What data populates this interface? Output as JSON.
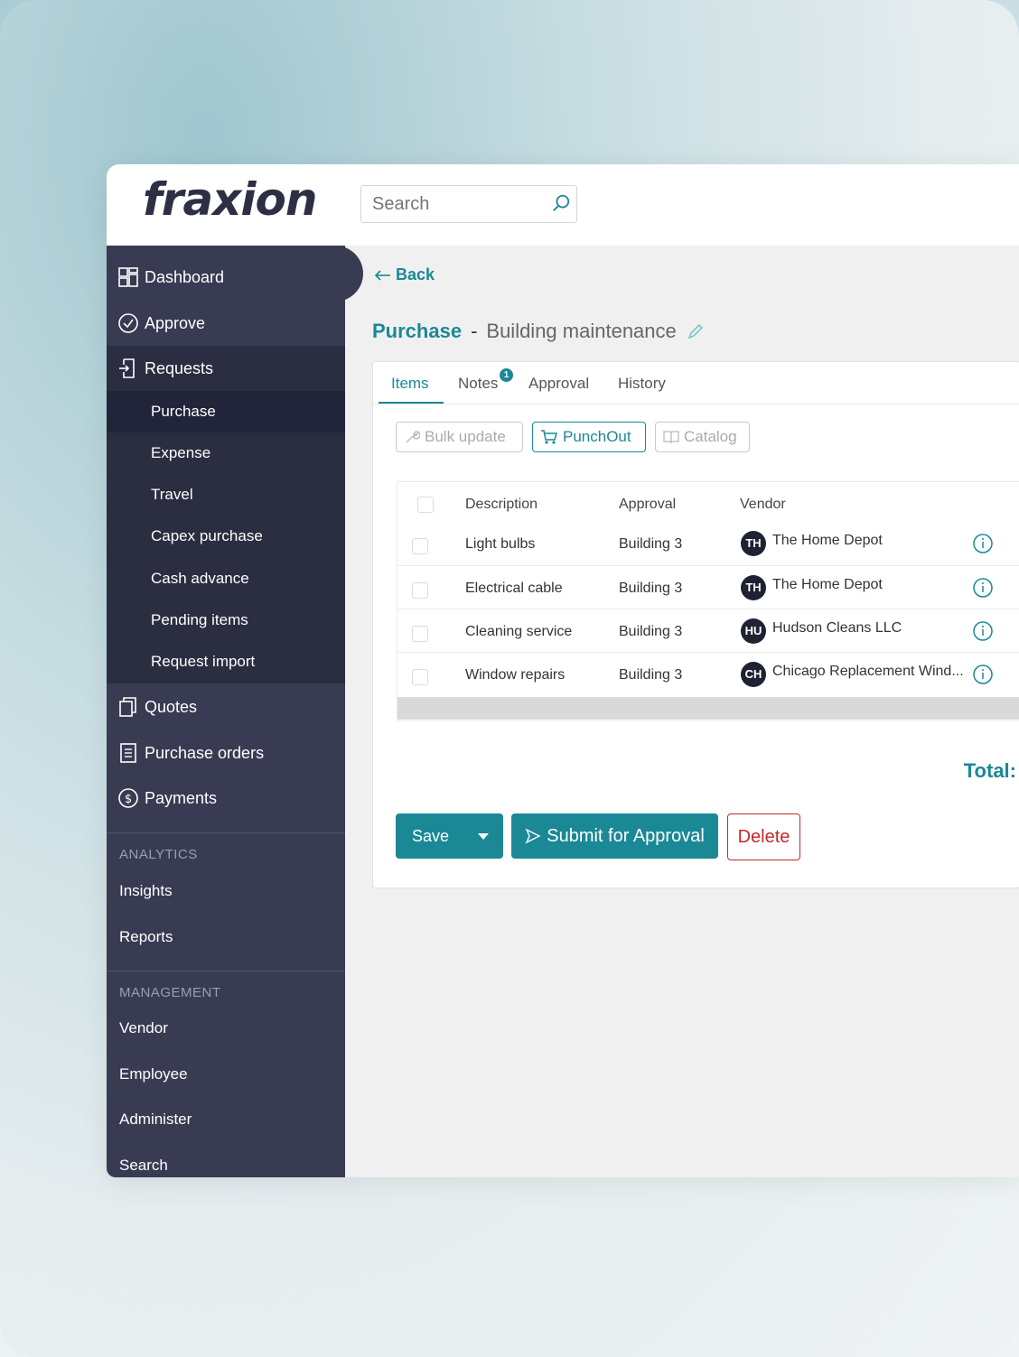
{
  "app": {
    "logo": "fraxion"
  },
  "search": {
    "placeholder": "Search"
  },
  "sidebar": {
    "main": [
      {
        "label": "Dashboard",
        "icon": "dashboard-icon"
      },
      {
        "label": "Approve",
        "icon": "check-circle-icon"
      },
      {
        "label": "Requests",
        "icon": "request-icon"
      }
    ],
    "requests_sub": [
      {
        "label": "Purchase",
        "selected": true
      },
      {
        "label": "Expense"
      },
      {
        "label": "Travel"
      },
      {
        "label": "Capex purchase"
      },
      {
        "label": "Cash advance"
      },
      {
        "label": "Pending items"
      },
      {
        "label": "Request import"
      }
    ],
    "more": [
      {
        "label": "Quotes",
        "icon": "quotes-icon"
      },
      {
        "label": "Purchase orders",
        "icon": "document-icon"
      },
      {
        "label": "Payments",
        "icon": "dollar-circle-icon"
      }
    ],
    "analytics": {
      "heading": "ANALYTICS",
      "items": [
        "Insights",
        "Reports"
      ]
    },
    "management": {
      "heading": "MANAGEMENT",
      "items": [
        "Vendor",
        "Employee",
        "Administer",
        "Search"
      ]
    }
  },
  "page": {
    "back": "Back",
    "title": "Purchase",
    "separator": "-",
    "subtitle": "Building maintenance"
  },
  "tabs": [
    {
      "label": "Items",
      "active": true
    },
    {
      "label": "Notes",
      "badge": "1"
    },
    {
      "label": "Approval"
    },
    {
      "label": "History"
    }
  ],
  "toolbar": {
    "bulk_update": "Bulk update",
    "punchout": "PunchOut",
    "catalog": "Catalog"
  },
  "table": {
    "headers": [
      "Description",
      "Approval",
      "Vendor"
    ],
    "rows": [
      {
        "description": "Light bulbs",
        "approval": "Building 3",
        "vendor_initials": "TH",
        "vendor": "The Home Depot"
      },
      {
        "description": "Electrical cable",
        "approval": "Building 3",
        "vendor_initials": "TH",
        "vendor": "The Home Depot"
      },
      {
        "description": "Cleaning service",
        "approval": "Building 3",
        "vendor_initials": "HU",
        "vendor": "Hudson Cleans LLC"
      },
      {
        "description": "Window repairs",
        "approval": "Building 3",
        "vendor_initials": "CH",
        "vendor": "Chicago Replacement Wind..."
      }
    ]
  },
  "total_label": "Total:",
  "actions": {
    "save": "Save",
    "submit": "Submit for Approval",
    "delete": "Delete"
  },
  "colors": {
    "accent": "#1b8896",
    "sidebar": "#383b52",
    "delete": "#c62828"
  }
}
